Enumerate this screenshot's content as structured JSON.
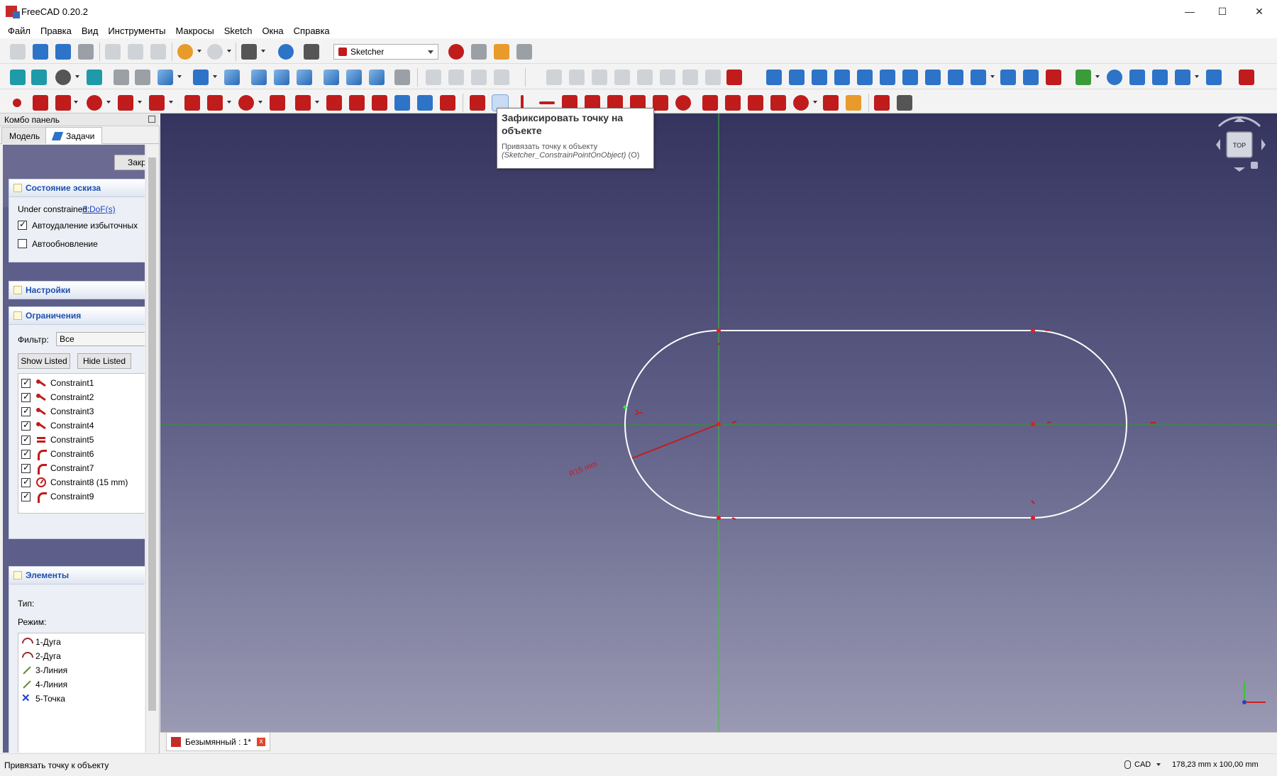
{
  "window": {
    "title": "FreeCAD 0.20.2",
    "minimize": "—",
    "maximize": "☐",
    "close": "✕"
  },
  "menu": [
    "Файл",
    "Правка",
    "Вид",
    "Инструменты",
    "Макросы",
    "Sketch",
    "Окна",
    "Справка"
  ],
  "workbench": "Sketcher",
  "combo": {
    "title": "Комбо панель",
    "tabs": [
      "Модель",
      "Задачи"
    ],
    "close_button": "Закрыть"
  },
  "sketch_state": {
    "header": "Состояние эскиза",
    "under_constrained_label": "Under constrained:",
    "dof_link": "3 DoF(s)",
    "auto_remove_label": "Автоудаление избыточных",
    "auto_remove_checked": true,
    "auto_update_label": "Автообновление",
    "auto_update_checked": false
  },
  "settings": {
    "header": "Настройки"
  },
  "constraints": {
    "header": "Ограничения",
    "filter_label": "Фильтр:",
    "filter_value": "Все",
    "show_listed": "Show Listed",
    "hide_listed": "Hide Listed",
    "items": [
      {
        "name": "Constraint1",
        "icon": "coincident-icon"
      },
      {
        "name": "Constraint2",
        "icon": "coincident-icon"
      },
      {
        "name": "Constraint3",
        "icon": "coincident-icon"
      },
      {
        "name": "Constraint4",
        "icon": "coincident-icon"
      },
      {
        "name": "Constraint5",
        "icon": "equal-icon"
      },
      {
        "name": "Constraint6",
        "icon": "point-on-object-icon"
      },
      {
        "name": "Constraint7",
        "icon": "point-on-object-icon"
      },
      {
        "name": "Constraint8 (15 mm)",
        "icon": "radius-icon"
      },
      {
        "name": "Constraint9",
        "icon": "point-on-object-icon"
      }
    ]
  },
  "elements": {
    "header": "Элементы",
    "type_label": "Тип:",
    "mode_label": "Режим:",
    "items": [
      {
        "name": "1-Дуга",
        "icon": "arc-icon"
      },
      {
        "name": "2-Дуга",
        "icon": "arc-icon"
      },
      {
        "name": "3-Линия",
        "icon": "line-icon"
      },
      {
        "name": "4-Линия",
        "icon": "line-icon"
      },
      {
        "name": "5-Точка",
        "icon": "point-icon"
      }
    ]
  },
  "view": {
    "radius_label": "R15 mm",
    "navcube_face": "TOP",
    "colors": {
      "geometry": "#ffffff",
      "constraint": "#c41c1c",
      "axis_v": "#3fbf3f",
      "axis_h": "#2a9a2a"
    }
  },
  "doc_tab": {
    "label": "Безымянный : 1*",
    "close": "x"
  },
  "tooltip": {
    "title": "Зафиксировать точку на объекте",
    "description": "Привязать точку к объекту",
    "command": "(Sketcher_ConstrainPointOnObject)",
    "shortcut": " (O)"
  },
  "status": {
    "message": "Привязать точку к объекту",
    "nav_style": "CAD",
    "dimensions": "178,23 mm x 100,00 mm"
  }
}
